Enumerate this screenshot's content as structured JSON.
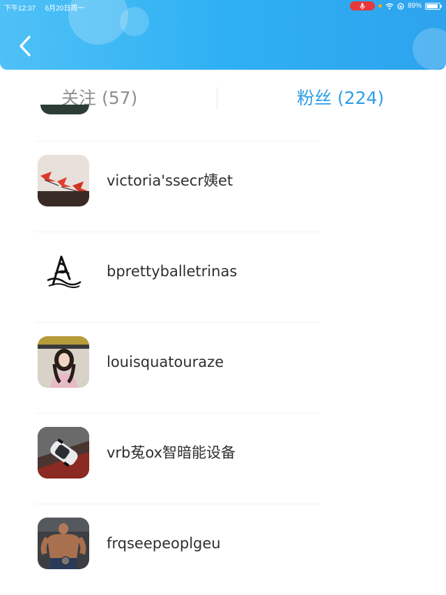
{
  "status_bar": {
    "time": "下午12:37",
    "date": "6月20日周一",
    "battery": "89%",
    "battery_level": 0.89
  },
  "header": {
    "back_icon": "chevron-left-icon"
  },
  "tabs": [
    {
      "label": "关注 (57)",
      "active": false
    },
    {
      "label": "粉丝 (224)",
      "active": true
    }
  ],
  "colors": {
    "header_gradient_start": "#4fc1f6",
    "header_gradient_end": "#2ea3ee",
    "active_tab": "#2d9ee8",
    "inactive_tab": "#8e8e8e",
    "name_text": "#2f2f2f"
  },
  "followers": [
    {
      "name": "victoria'ssecr姨et",
      "avatar": "paper-cranes-photo"
    },
    {
      "name": "bprettyballetrinas",
      "avatar": "ballet-logo"
    },
    {
      "name": "louisquatouraze",
      "avatar": "girl-portrait-photo"
    },
    {
      "name": "vrb菟ox智暗能设备",
      "avatar": "car-photo"
    },
    {
      "name": "frqseepeoplgeu",
      "avatar": "bodybuilder-photo"
    }
  ]
}
